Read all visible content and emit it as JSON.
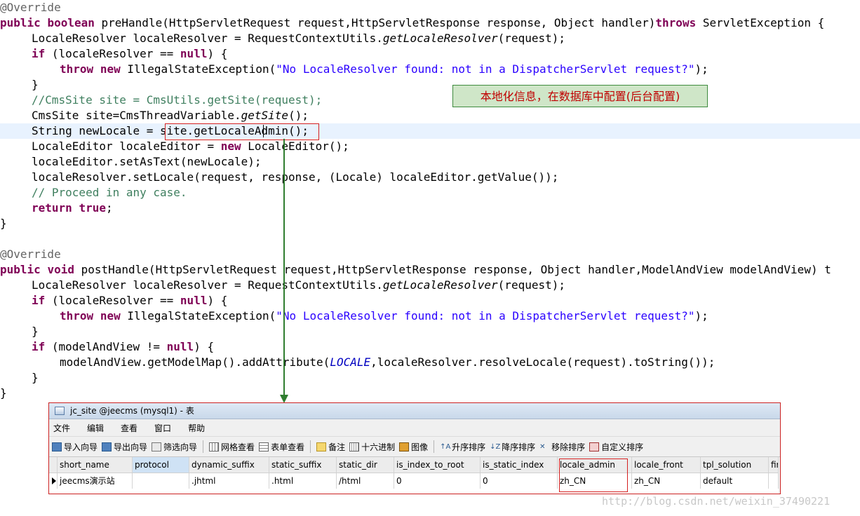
{
  "code": {
    "l1": "@Override",
    "l2_public": "public",
    "l2_boolean": "boolean",
    "l2_sig": " preHandle(HttpServletRequest request,HttpServletResponse response, Object handler)",
    "l2_throws": "throws",
    "l2_tail": " ServletException {",
    "l3a": "LocaleResolver localeResolver = RequestContextUtils.",
    "l3b": "getLocaleResolver",
    "l3c": "(request);",
    "l4_if": "if",
    "l4a": " (localeResolver == ",
    "l4_null": "null",
    "l4b": ") {",
    "l5_throw": "throw",
    "l5_new": "new",
    "l5a": " IllegalStateException(",
    "l5_str": "\"No LocaleResolver found: not in a DispatcherServlet request?\"",
    "l5b": ");",
    "close_brace": "}",
    "l7": "//CmsSite site = CmsUtils.getSite(request);",
    "l8a": "CmsSite site=CmsThreadVariable.",
    "l8b": "getSite",
    "l8c": "();",
    "l9": "String newLocale = site.getLocaleAdmin();",
    "l10a": "LocaleEditor localeEditor = ",
    "l10_new": "new",
    "l10b": " LocaleEditor();",
    "l11": "localeEditor.setAsText(newLocale);",
    "l12": "localeResolver.setLocale(request, response, (Locale) localeEditor.getValue());",
    "l13": "// Proceed in any case.",
    "l14_return": "return",
    "l14_true": "true",
    "l14b": ";",
    "l17": "@Override",
    "l18_public": "public",
    "l18_void": "void",
    "l18_sig": " postHandle(HttpServletRequest request,HttpServletResponse response, Object handler,ModelAndView modelAndView) t",
    "l22_if": "if",
    "l22a": " (modelAndView != ",
    "l22_null": "null",
    "l22b": ") {",
    "l23a": "modelAndView.getModelMap().addAttribute(",
    "l23b": "LOCALE",
    "l23c": ",localeResolver.resolveLocale(request).toString());"
  },
  "callout": "本地化信息，在数据库中配置(后台配置)",
  "window": {
    "title": "jc_site @jeecms (mysql1) - 表",
    "menu": [
      "文件",
      "编辑",
      "查看",
      "窗口",
      "帮助"
    ],
    "toolbar": [
      "导入向导",
      "导出向导",
      "筛选向导",
      "网格查看",
      "表单查看",
      "备注",
      "十六进制",
      "图像",
      "升序排序",
      "降序排序",
      "移除排序",
      "自定义排序"
    ],
    "columns": [
      "short_name",
      "protocol",
      "dynamic_suffix",
      "static_suffix",
      "static_dir",
      "is_index_to_root",
      "is_static_index",
      "locale_admin",
      "locale_front",
      "tpl_solution",
      "fir"
    ],
    "row": [
      "jeecms演示站",
      "",
      ".jhtml",
      ".html",
      "/html",
      "0",
      "0",
      "zh_CN",
      "zh_CN",
      "default",
      ""
    ]
  },
  "watermark": "http://blog.csdn.net/weixin_37490221"
}
